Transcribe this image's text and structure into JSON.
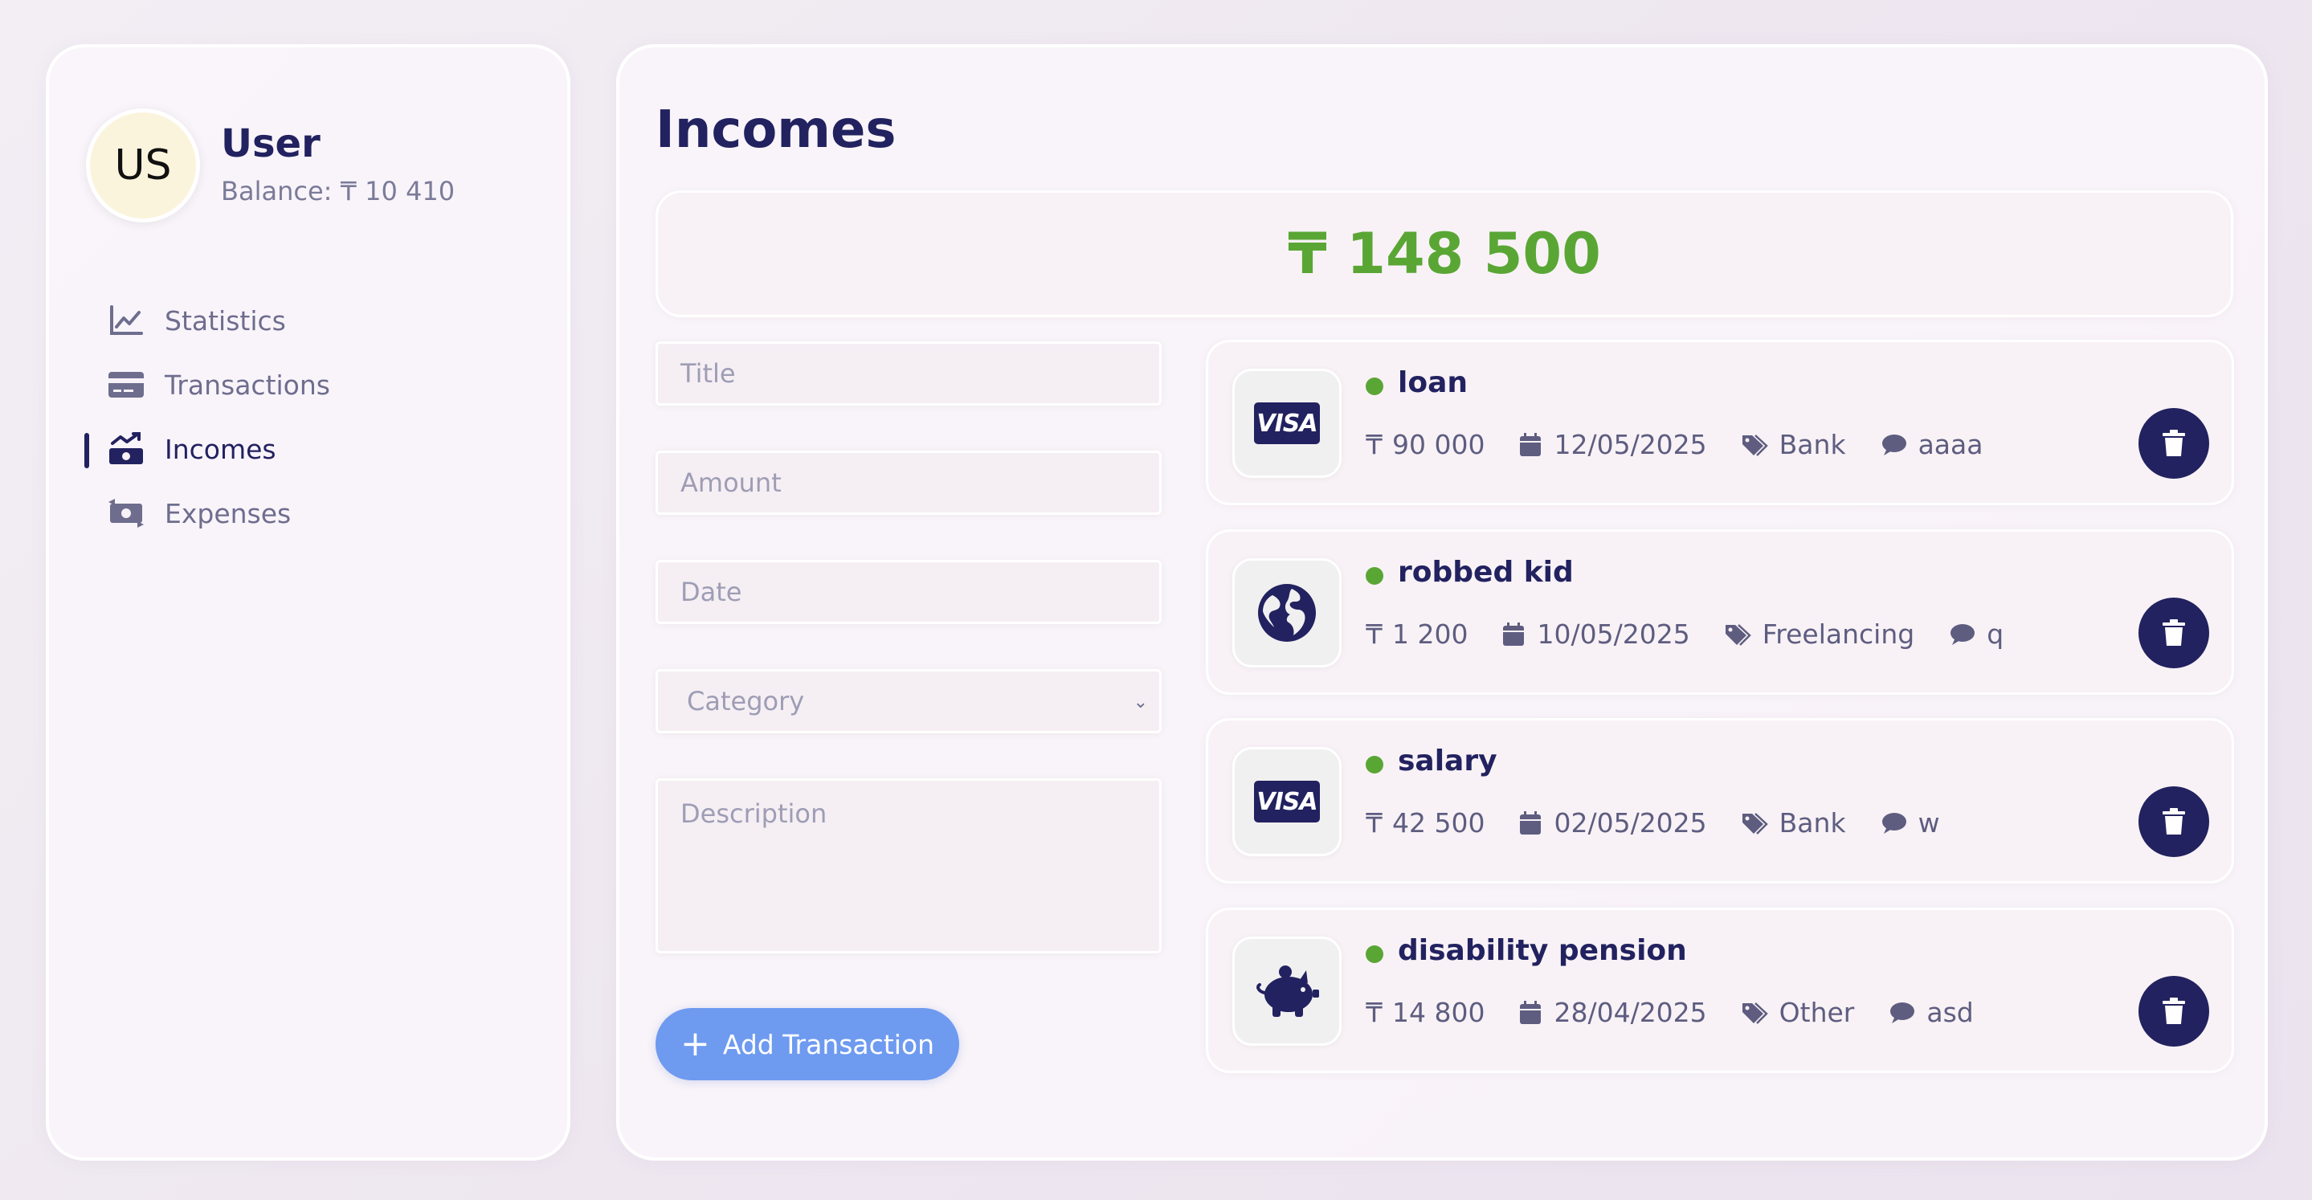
{
  "user": {
    "initials": "US",
    "name": "User",
    "balance": "Balance: ₸ 10 410"
  },
  "nav": [
    {
      "label": "Statistics",
      "icon": "chart-line-icon"
    },
    {
      "label": "Transactions",
      "icon": "credit-card-icon"
    },
    {
      "label": "Incomes",
      "icon": "money-trend-icon",
      "active": true
    },
    {
      "label": "Expenses",
      "icon": "money-exchange-icon"
    }
  ],
  "page": {
    "title": "Incomes",
    "total": "₸ 148 500"
  },
  "form": {
    "title_placeholder": "Title",
    "amount_placeholder": "Amount",
    "date_placeholder": "Date",
    "category_placeholder": "Category",
    "description_placeholder": "Description",
    "add_label": "Add Transaction"
  },
  "transactions": [
    {
      "title": "loan",
      "amount": "90 000",
      "date": "12/05/2025",
      "category": "Bank",
      "note": "aaaa",
      "icon": "visa-icon"
    },
    {
      "title": "robbed kid",
      "amount": "1 200",
      "date": "10/05/2025",
      "category": "Freelancing",
      "note": "q",
      "icon": "globe-icon"
    },
    {
      "title": "salary",
      "amount": "42 500",
      "date": "02/05/2025",
      "category": "Bank",
      "note": "w",
      "icon": "visa-icon"
    },
    {
      "title": "disability pension",
      "amount": "14 800",
      "date": "28/04/2025",
      "category": "Other",
      "note": "asd",
      "icon": "piggy-bank-icon"
    }
  ],
  "colors": {
    "primary": "#222260",
    "income_green": "#5aa635",
    "button_blue": "#6e9af0"
  }
}
